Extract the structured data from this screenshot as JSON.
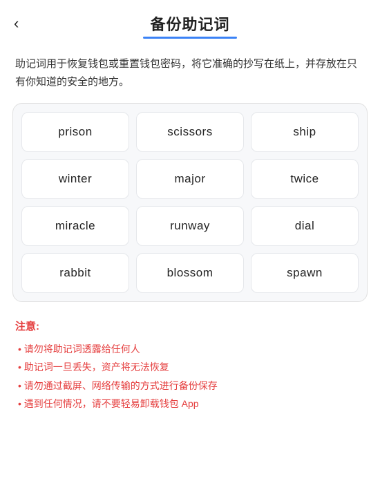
{
  "header": {
    "back_label": "‹",
    "title": "备份助记词"
  },
  "description": {
    "text": "助记词用于恢复钱包或重置钱包密码，将它准确的抄写在纸上，并存放在只有你知道的安全的地方。"
  },
  "mnemonic": {
    "words": [
      "prison",
      "scissors",
      "ship",
      "winter",
      "major",
      "twice",
      "miracle",
      "runway",
      "dial",
      "rabbit",
      "blossom",
      "spawn"
    ]
  },
  "notice": {
    "title": "注意:",
    "items": [
      "• 请勿将助记词透露给任何人",
      "• 助记词一旦丢失，资产将无法恢复",
      "• 请勿通过截屏、网络传输的方式进行备份保存",
      "• 遇到任何情况，请不要轻易卸载钱包 App"
    ]
  }
}
